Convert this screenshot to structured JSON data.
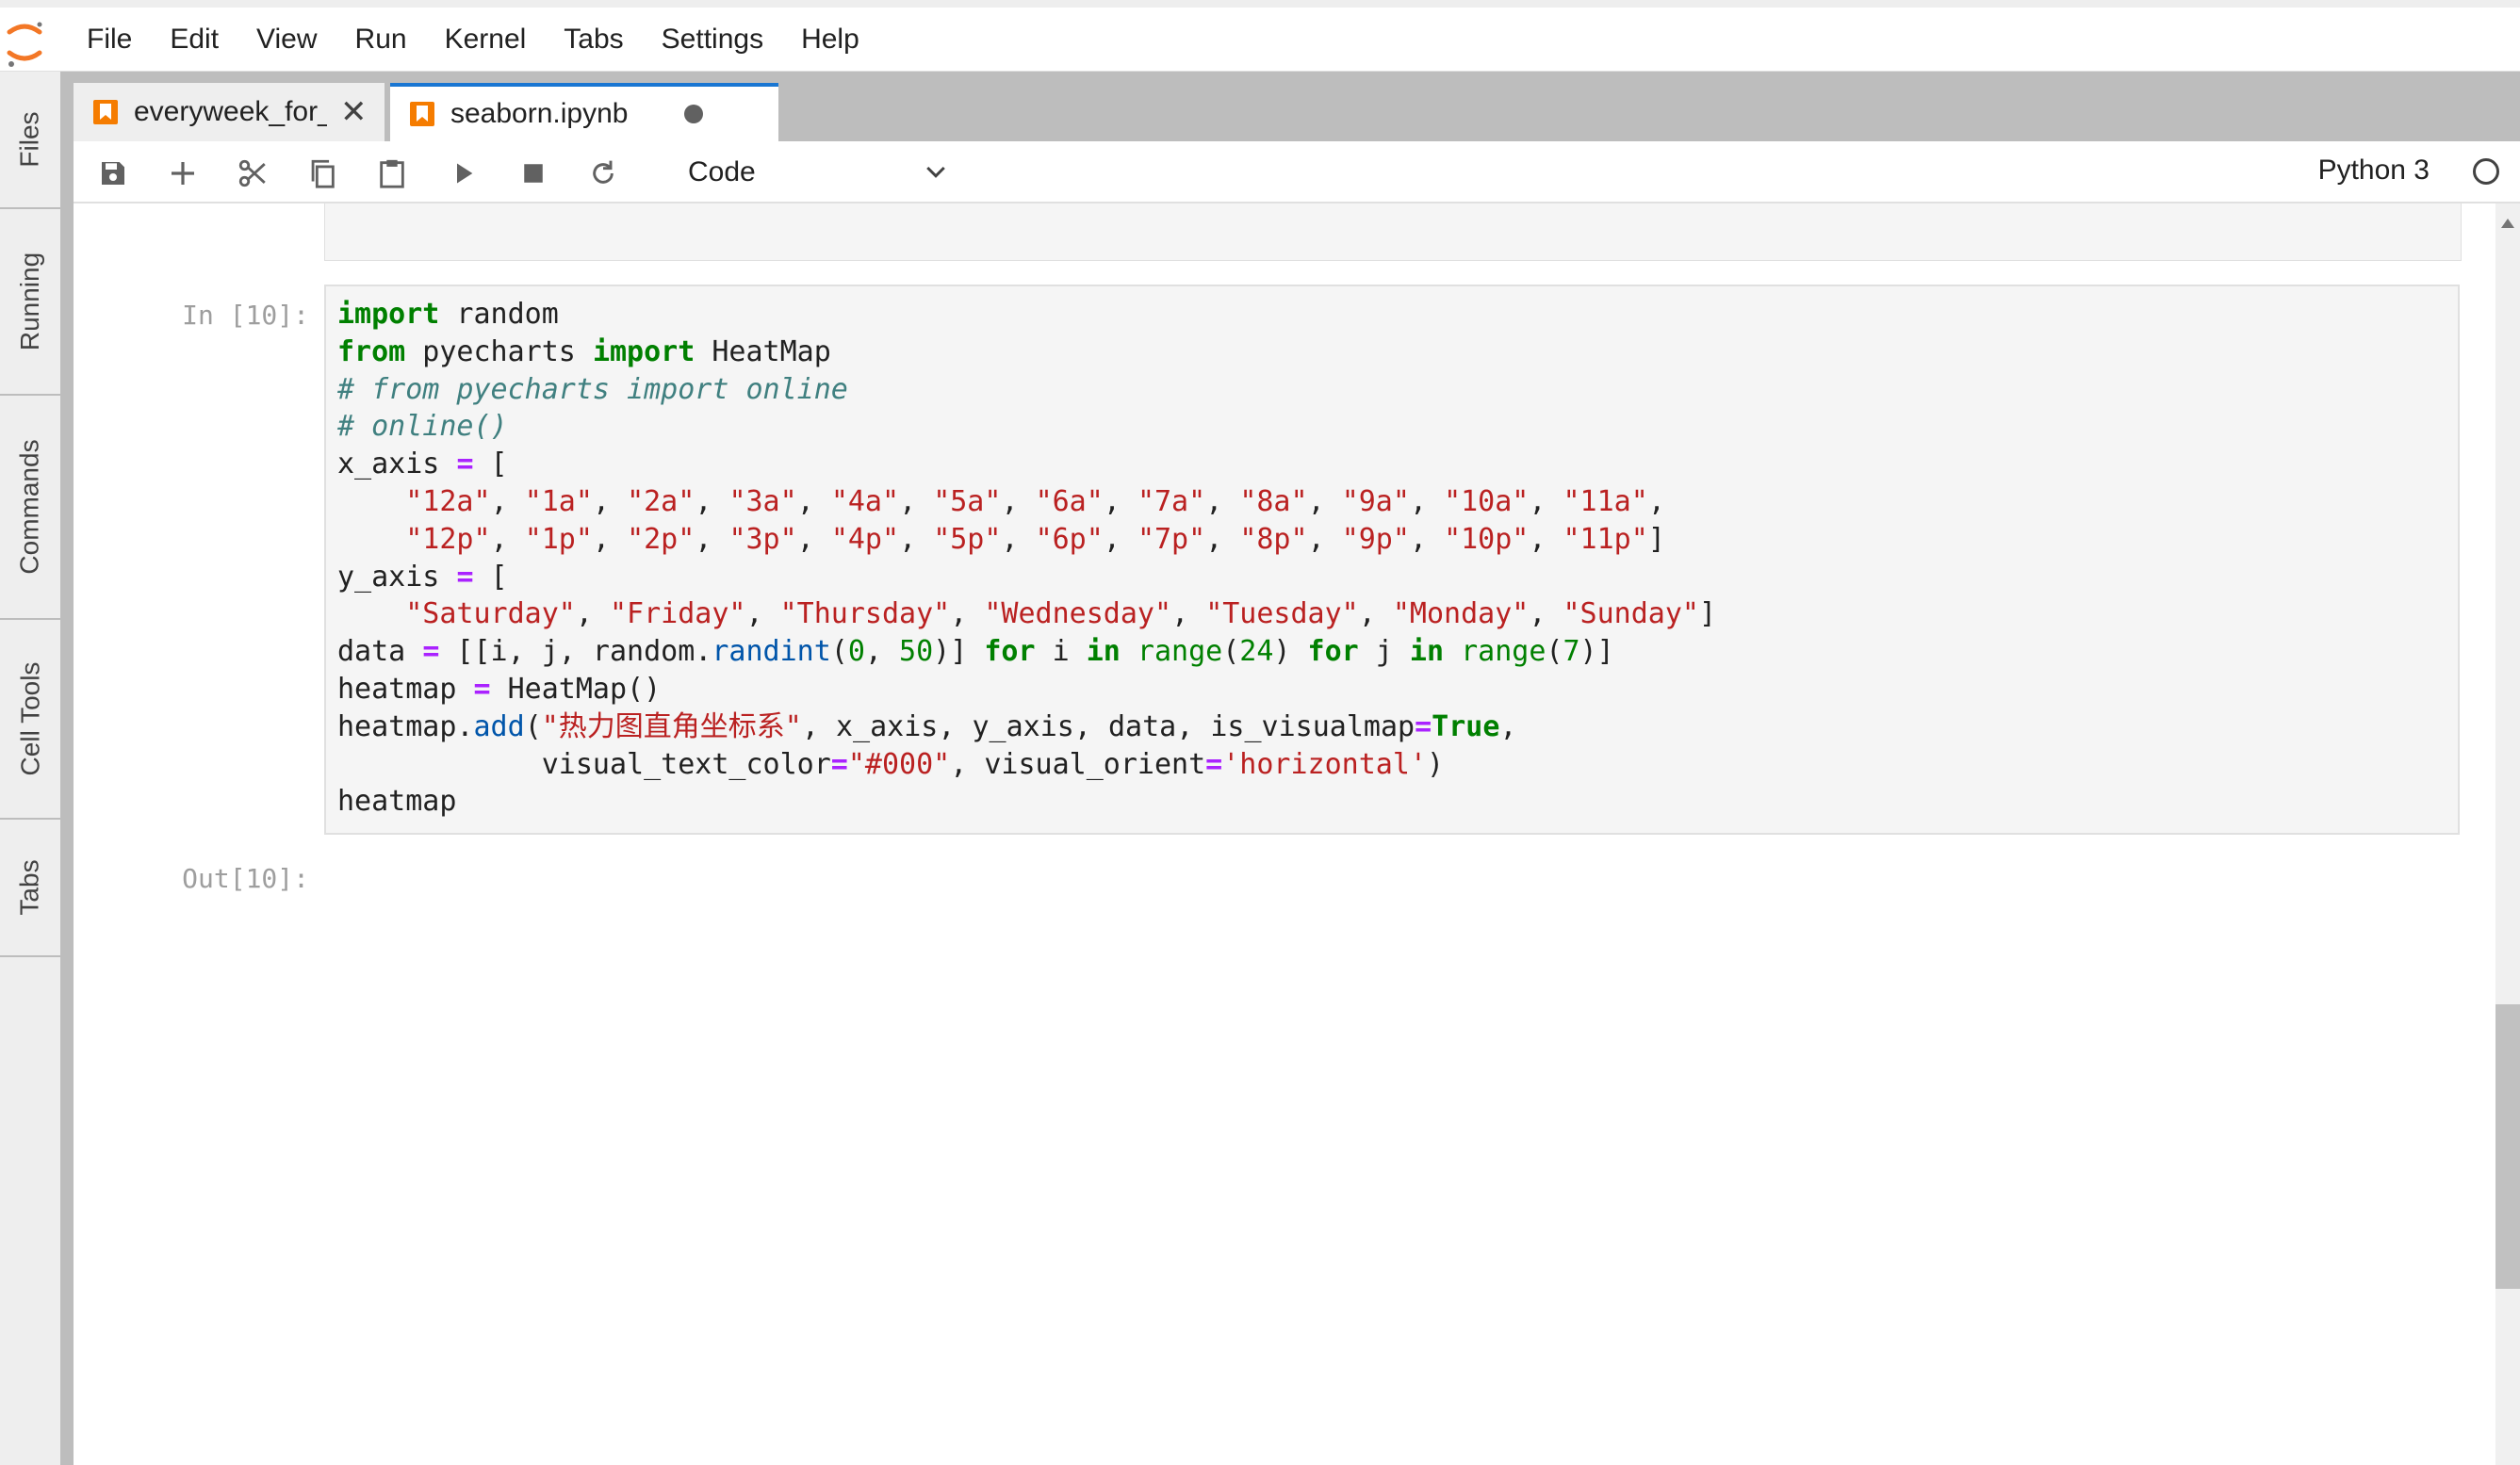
{
  "menu": {
    "items": [
      "File",
      "Edit",
      "View",
      "Run",
      "Kernel",
      "Tabs",
      "Settings",
      "Help"
    ]
  },
  "sidebar": {
    "tabs": [
      "Files",
      "Running",
      "Commands",
      "Cell Tools",
      "Tabs"
    ]
  },
  "tabs": [
    {
      "label": "everyweek_for_l",
      "close": "✕"
    },
    {
      "label": "seaborn.ipynb",
      "unsaved": true
    }
  ],
  "toolbar": {
    "cell_type": "Code",
    "kernel_name": "Python 3",
    "icons": [
      "save-icon",
      "add-cell-icon",
      "cut-icon",
      "copy-icon",
      "paste-icon",
      "run-icon",
      "stop-icon",
      "restart-icon"
    ]
  },
  "cell": {
    "in_prompt": "In [10]:",
    "out_prompt": "Out[10]:",
    "code_lines": [
      "import random",
      "from pyecharts import HeatMap",
      "# from pyecharts import online",
      "# online()",
      "x_axis = [",
      "    \"12a\", \"1a\", \"2a\", \"3a\", \"4a\", \"5a\", \"6a\", \"7a\", \"8a\", \"9a\", \"10a\", \"11a\",",
      "    \"12p\", \"1p\", \"2p\", \"3p\", \"4p\", \"5p\", \"6p\", \"7p\", \"8p\", \"9p\", \"10p\", \"11p\"]",
      "y_axis = [",
      "    \"Saturday\", \"Friday\", \"Thursday\", \"Wednesday\", \"Tuesday\", \"Monday\", \"Sunday\"]",
      "data = [[i, j, random.randint(0, 50)] for i in range(24) for j in range(7)]",
      "heatmap = HeatMap()",
      "heatmap.add(\"热力图直角坐标系\", x_axis, y_axis, data, is_visualmap=True,",
      "            visual_text_color=\"#000\", visual_orient='horizontal')",
      "heatmap"
    ]
  },
  "colors": {
    "keyword": "#008000",
    "string": "#ba2121",
    "comment": "#408080",
    "operator": "#aa22ff",
    "accent": "#1976d2",
    "notebook_icon": "#f57c00"
  }
}
